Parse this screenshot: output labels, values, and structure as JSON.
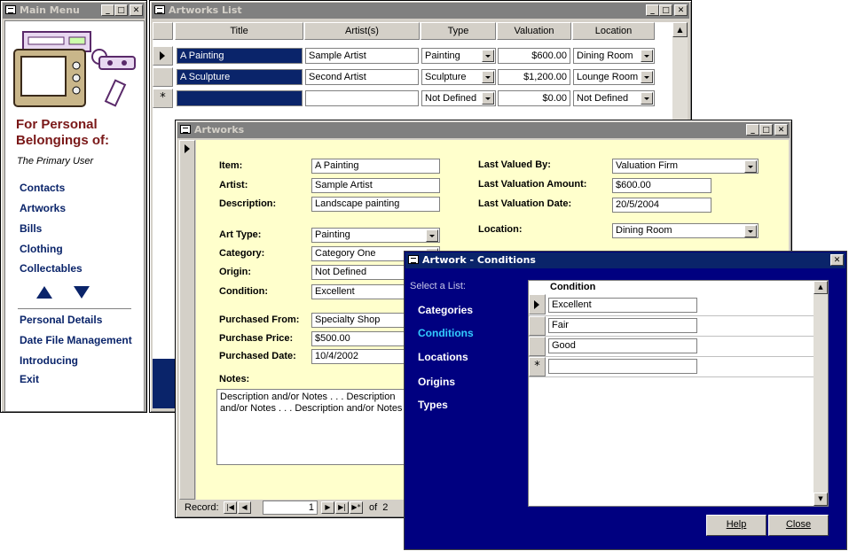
{
  "main_menu": {
    "title": "Main Menu",
    "heading_line1": "For Personal",
    "heading_line2": "Belongings of:",
    "owner": "The Primary User",
    "nav": [
      "Contacts",
      "Artworks",
      "Bills",
      "Clothing",
      "Collectables"
    ],
    "links": [
      "Personal Details",
      "Date File Management",
      "Introducing",
      "Exit"
    ]
  },
  "artworks_list": {
    "title": "Artworks List",
    "columns": [
      "Title",
      "Artist(s)",
      "Type",
      "Valuation",
      "Location"
    ],
    "rows": [
      {
        "title": "A Painting",
        "artist": "Sample Artist",
        "type": "Painting",
        "valuation": "$600.00",
        "location": "Dining Room"
      },
      {
        "title": "A Sculpture",
        "artist": "Second Artist",
        "type": "Sculpture",
        "valuation": "$1,200.00",
        "location": "Lounge Room"
      },
      {
        "title": "",
        "artist": "",
        "type": "Not Defined",
        "valuation": "$0.00",
        "location": "Not Defined"
      }
    ],
    "new_record_marker": "*"
  },
  "artworks_form": {
    "title": "Artworks",
    "labels": {
      "item": "Item:",
      "artist": "Artist:",
      "description": "Description:",
      "art_type": "Art Type:",
      "category": "Category:",
      "origin": "Origin:",
      "condition": "Condition:",
      "purchased_from": "Purchased From:",
      "purchase_price": "Purchase Price:",
      "purchased_date": "Purchased Date:",
      "notes": "Notes:",
      "last_valued_by": "Last Valued By:",
      "last_valuation_amount": "Last Valuation Amount:",
      "last_valuation_date": "Last Valuation Date:",
      "location": "Location:"
    },
    "values": {
      "item": "A Painting",
      "artist": "Sample Artist",
      "description": "Landscape painting",
      "art_type": "Painting",
      "category": "Category One",
      "origin": "Not Defined",
      "condition": "Excellent",
      "purchased_from": "Specialty Shop",
      "purchase_price": "$500.00",
      "purchased_date": "10/4/2002",
      "notes": "Description and/or Notes . . .  Description and/or Notes . . .  Description and/or Notes",
      "last_valued_by": "Valuation Firm",
      "last_valuation_amount": "$600.00",
      "last_valuation_date": "20/5/2004",
      "location": "Dining Room"
    },
    "record_label": "Record:",
    "record_current": "1",
    "record_of": "of  2"
  },
  "conditions_dialog": {
    "title": "Artwork - Conditions",
    "select_label": "Select a List:",
    "lists": [
      "Categories",
      "Conditions",
      "Locations",
      "Origins",
      "Types"
    ],
    "active_list": "Conditions",
    "column_header": "Condition",
    "items": [
      "Excellent",
      "Fair",
      "Good",
      ""
    ],
    "help_label": "Help",
    "close_label": "Close"
  },
  "colors": {
    "navy": "#0a246a",
    "form_bg": "#ffffcc",
    "dialog_bg": "#000080",
    "heading_red": "#7a1818",
    "active_list": "#33ccff"
  }
}
